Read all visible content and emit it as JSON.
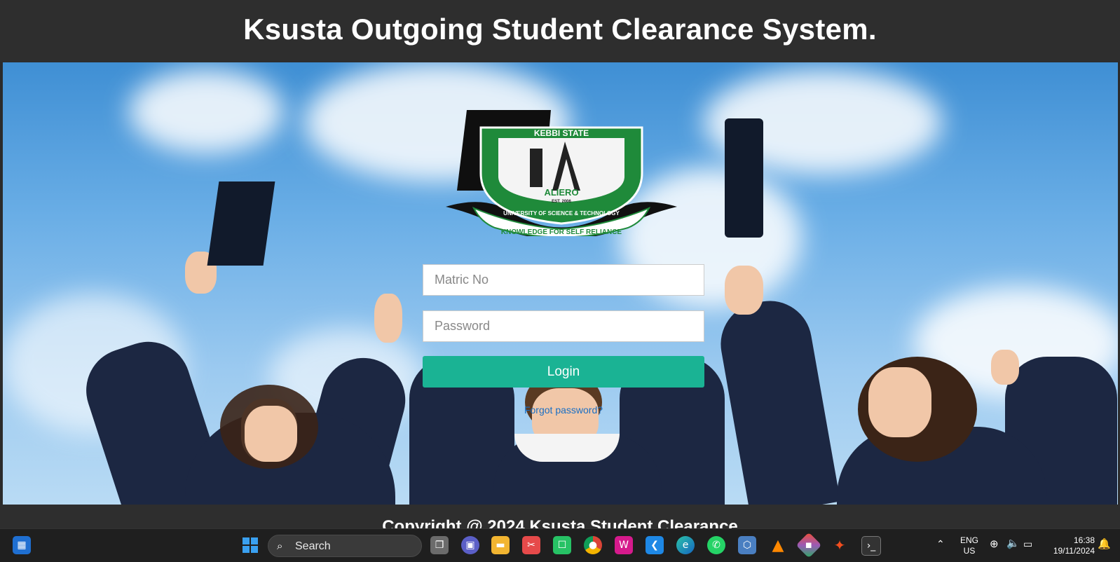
{
  "header": {
    "title": "Ksusta Outgoing Student Clearance System."
  },
  "logo": {
    "top_text": "KEBBI STATE",
    "est": "EST. 2006",
    "city": "ALIERO",
    "ring_text": "UNIVERSITY OF SCIENCE & TECHNOLOGY",
    "motto": "KNOWLEDGE FOR SELF RELIANCE"
  },
  "login": {
    "matric_placeholder": "Matric No",
    "password_placeholder": "Password",
    "login_label": "Login",
    "forgot_label": "Forgot password?"
  },
  "colors": {
    "accent": "#1ab394",
    "header_bg": "#2e2e2e",
    "link": "#1a6fc4",
    "logo_green": "#1f8a3a"
  },
  "footer": {
    "text": "Copyright @ 2024 Ksusta Student Clearance"
  },
  "taskbar": {
    "search_label": "Search",
    "apps": [
      "widgets-icon",
      "start-icon",
      "task-view-icon",
      "teams-icon",
      "file-explorer-icon",
      "snipping-tool-icon",
      "phone-link-icon",
      "chrome-icon",
      "wampserver-icon",
      "vscode-icon",
      "edge-icon",
      "whatsapp-icon",
      "virtualbox-icon",
      "vlc-icon",
      "git-icon",
      "figma-icon",
      "terminal-icon"
    ],
    "language": "ENG",
    "region": "US",
    "time": "16:38",
    "date": "19/11/2024"
  }
}
